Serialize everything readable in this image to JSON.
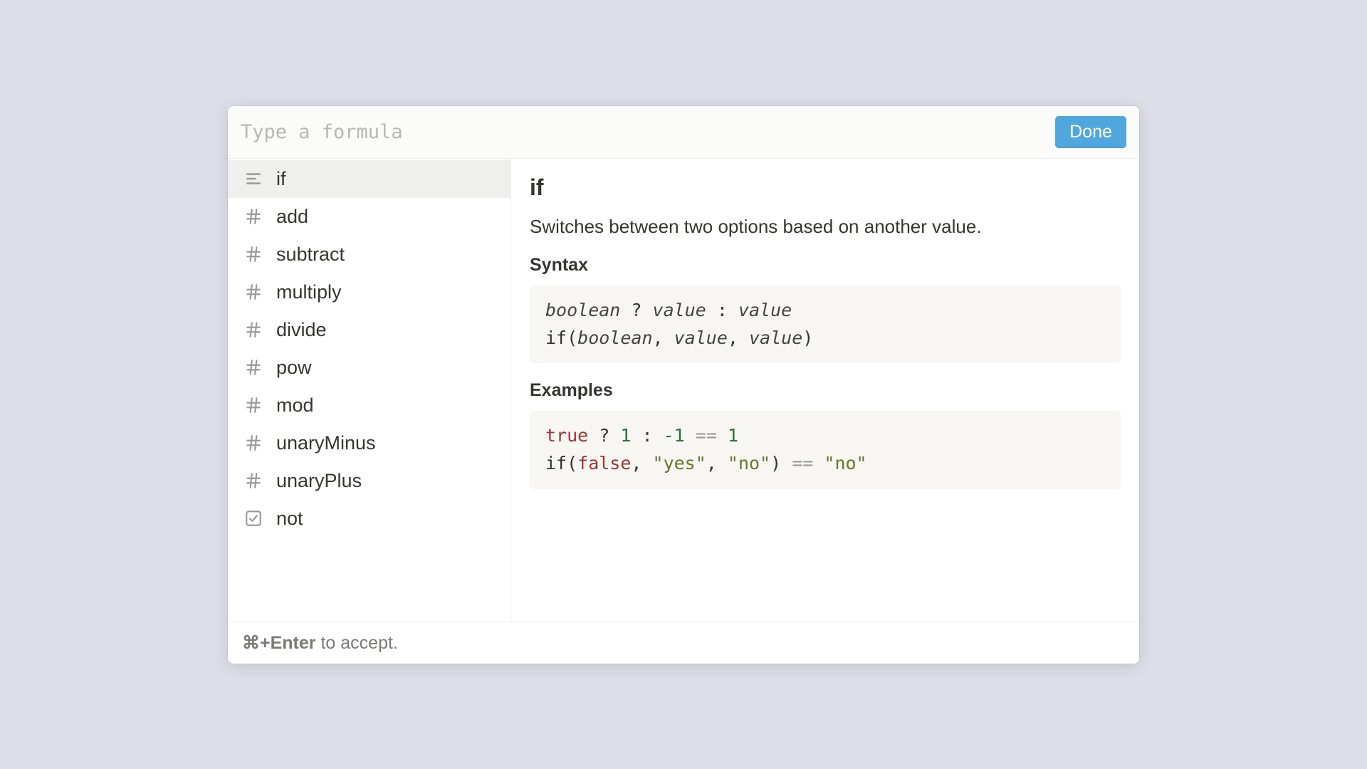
{
  "header": {
    "placeholder": "Type a formula",
    "value": "",
    "done_label": "Done"
  },
  "sidebar": {
    "items": [
      {
        "label": "if",
        "icon": "text",
        "selected": true
      },
      {
        "label": "add",
        "icon": "number",
        "selected": false
      },
      {
        "label": "subtract",
        "icon": "number",
        "selected": false
      },
      {
        "label": "multiply",
        "icon": "number",
        "selected": false
      },
      {
        "label": "divide",
        "icon": "number",
        "selected": false
      },
      {
        "label": "pow",
        "icon": "number",
        "selected": false
      },
      {
        "label": "mod",
        "icon": "number",
        "selected": false
      },
      {
        "label": "unaryMinus",
        "icon": "number",
        "selected": false
      },
      {
        "label": "unaryPlus",
        "icon": "number",
        "selected": false
      },
      {
        "label": "not",
        "icon": "check",
        "selected": false
      }
    ]
  },
  "detail": {
    "title": "if",
    "description": "Switches between two options based on another value.",
    "syntax_heading": "Syntax",
    "syntax_lines": [
      [
        {
          "t": "boolean",
          "c": "arg"
        },
        {
          "t": " ? "
        },
        {
          "t": "value",
          "c": "arg"
        },
        {
          "t": " : "
        },
        {
          "t": "value",
          "c": "arg"
        }
      ],
      [
        {
          "t": "if("
        },
        {
          "t": "boolean",
          "c": "arg"
        },
        {
          "t": ", "
        },
        {
          "t": "value",
          "c": "arg"
        },
        {
          "t": ", "
        },
        {
          "t": "value",
          "c": "arg"
        },
        {
          "t": ")"
        }
      ]
    ],
    "examples_heading": "Examples",
    "example_lines": [
      [
        {
          "t": "true",
          "c": "kw"
        },
        {
          "t": " ? "
        },
        {
          "t": "1",
          "c": "num"
        },
        {
          "t": " : "
        },
        {
          "t": "-1",
          "c": "num"
        },
        {
          "t": " "
        },
        {
          "t": "==",
          "c": "op"
        },
        {
          "t": " "
        },
        {
          "t": "1",
          "c": "num"
        }
      ],
      [
        {
          "t": "if("
        },
        {
          "t": "false",
          "c": "kw"
        },
        {
          "t": ", "
        },
        {
          "t": "\"yes\"",
          "c": "str"
        },
        {
          "t": ", "
        },
        {
          "t": "\"no\"",
          "c": "str"
        },
        {
          "t": ") "
        },
        {
          "t": "==",
          "c": "op"
        },
        {
          "t": " "
        },
        {
          "t": "\"no\"",
          "c": "str"
        }
      ]
    ]
  },
  "footer": {
    "shortcut": "⌘+Enter",
    "rest": " to accept."
  }
}
